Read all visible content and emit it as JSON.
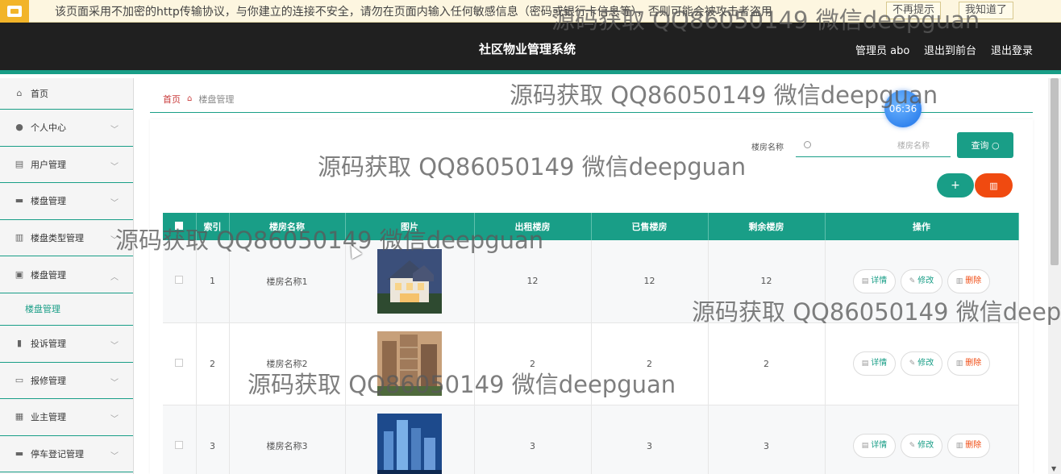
{
  "banner": {
    "text": "该页面采用不加密的http传输协议，与你建立的连接不安全，请勿在页面内输入任何敏感信息（密码或银行卡信息等），否则可能会被攻击者盗用",
    "dont_remind": "不再提示",
    "got_it": "我知道了"
  },
  "header": {
    "title": "社区物业管理系统",
    "user": "管理员 abo",
    "to_front": "退出到前台",
    "logout": "退出登录"
  },
  "sidebar": {
    "items": [
      {
        "label": "首页",
        "icon": "home-icon"
      },
      {
        "label": "个人中心",
        "icon": "user-icon"
      },
      {
        "label": "用户管理",
        "icon": "clipboard-icon"
      },
      {
        "label": "楼盘管理",
        "icon": "briefcase-icon"
      },
      {
        "label": "楼盘类型管理",
        "icon": "columns-icon"
      },
      {
        "label": "楼盘管理",
        "icon": "clipboard-check-icon"
      },
      {
        "label": "投诉管理",
        "icon": "bar-chart-icon"
      },
      {
        "label": "报修管理",
        "icon": "message-icon"
      },
      {
        "label": "业主管理",
        "icon": "grid-icon"
      },
      {
        "label": "停车登记管理",
        "icon": "comment-icon"
      }
    ],
    "submenu": "楼盘管理"
  },
  "breadcrumb": {
    "home": "首页",
    "current": "楼盘管理"
  },
  "clock": "06:36",
  "search": {
    "label": "楼房名称",
    "placeholder": "楼房名称",
    "button": "查询"
  },
  "actions": {
    "add": "+",
    "delete": "删除"
  },
  "table": {
    "headers": [
      "",
      "索引",
      "楼房名称",
      "图片",
      "出租楼房",
      "已售楼房",
      "剩余楼房",
      "操作"
    ],
    "rows": [
      {
        "index": "1",
        "name": "楼房名称1",
        "rent": "12",
        "sold": "12",
        "left": "12"
      },
      {
        "index": "2",
        "name": "楼房名称2",
        "rent": "2",
        "sold": "2",
        "left": "2"
      },
      {
        "index": "3",
        "name": "楼房名称3",
        "rent": "3",
        "sold": "3",
        "left": "3"
      }
    ],
    "op_detail": "详情",
    "op_edit": "修改",
    "op_delete": "删除"
  },
  "watermarks": [
    "源码获取 QQ86050149 微信deepguan",
    "源码获取 QQ86050149 微信deepguan",
    "源码获取 QQ86050149 微信deepguan",
    "源码获取 QQ86050149 微信deepguan",
    "源码获取 QQ86050149 微信deepguan",
    "源码获取 QQ86050149 微信deep"
  ]
}
